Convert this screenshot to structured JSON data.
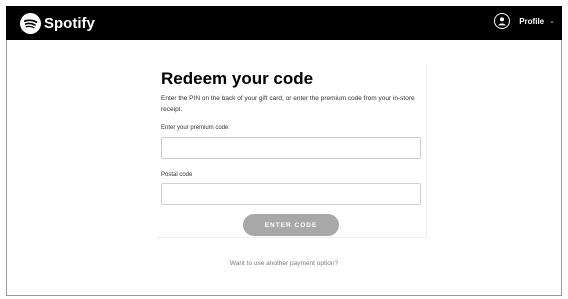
{
  "header": {
    "brand": "Spotify",
    "profile_label": "Profile",
    "profile_icon": "user-circle-icon",
    "chevron_icon": "chevron-down-icon",
    "background": "#000000"
  },
  "redeem": {
    "title": "Redeem your code",
    "description": "Enter the PIN on the back of your gift card, or enter the premium code from your in-store receipt.",
    "code_label": "Enter your premium code",
    "code_value": "",
    "postal_label": "Postal code",
    "postal_value": "",
    "submit_label": "ENTER CODE",
    "button_color": "#a8a8a8"
  },
  "alt_payment_link": "Want to use another payment option?"
}
